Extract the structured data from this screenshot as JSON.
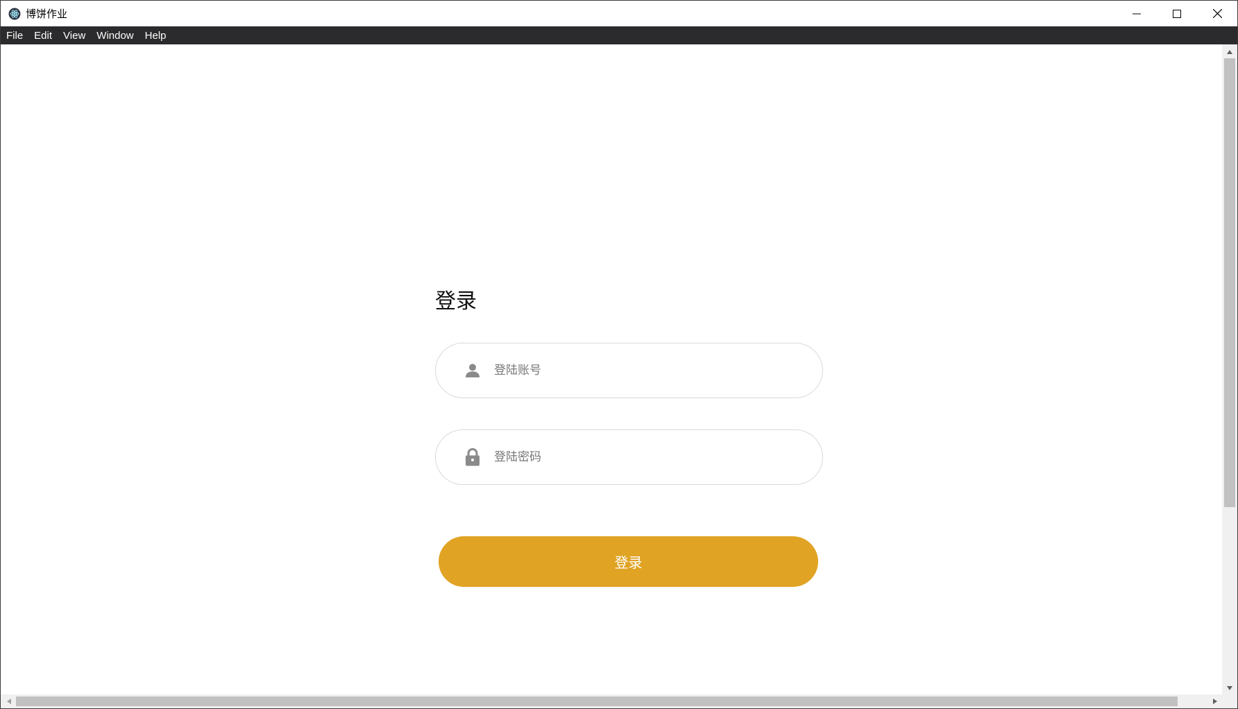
{
  "window": {
    "title": "博饼作业",
    "app_icon": "electron-atom-icon",
    "controls": [
      "minimize-icon",
      "maximize-icon",
      "close-icon"
    ]
  },
  "menu": {
    "items": [
      {
        "label": "File"
      },
      {
        "label": "Edit"
      },
      {
        "label": "View"
      },
      {
        "label": "Window"
      },
      {
        "label": "Help"
      }
    ]
  },
  "login": {
    "title": "登录",
    "account": {
      "placeholder": "登陆账号",
      "value": "",
      "icon": "user-icon"
    },
    "password": {
      "placeholder": "登陆密码",
      "value": "",
      "icon": "lock-icon"
    },
    "submit_label": "登录"
  },
  "colors": {
    "accent": "#e0a324",
    "menubar_bg": "#2b2b2d",
    "field_border": "#d9d9d9",
    "icon_gray": "#8a8a8a"
  }
}
